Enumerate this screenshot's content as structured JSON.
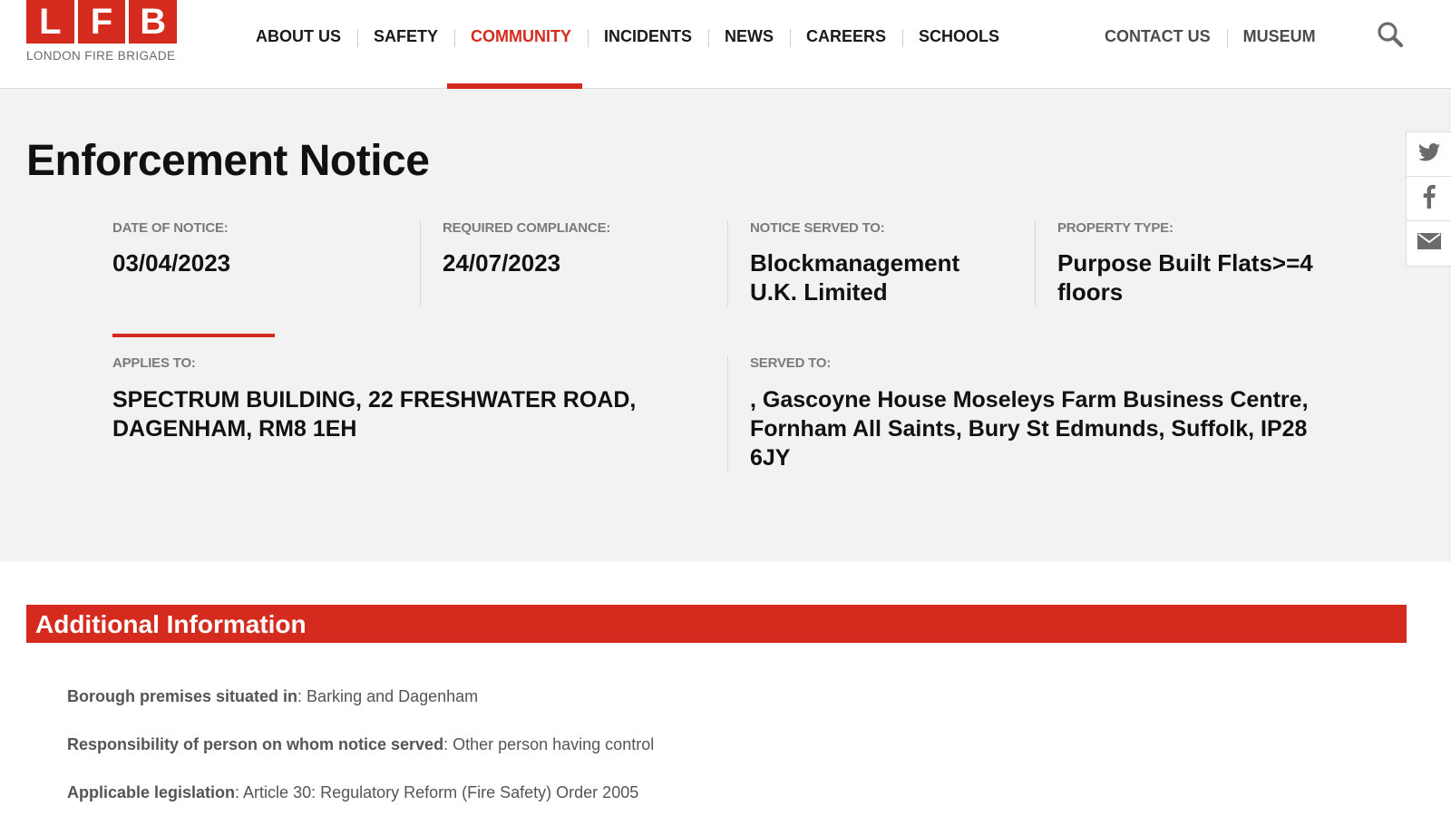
{
  "brand": {
    "logo_letters": [
      "L",
      "F",
      "B"
    ],
    "tagline": "LONDON FIRE BRIGADE",
    "accent_color": "#d52b1e"
  },
  "nav": {
    "items": [
      {
        "label": "ABOUT US"
      },
      {
        "label": "SAFETY"
      },
      {
        "label": "COMMUNITY",
        "active": true
      },
      {
        "label": "INCIDENTS"
      },
      {
        "label": "NEWS"
      },
      {
        "label": "CAREERS"
      },
      {
        "label": "SCHOOLS"
      }
    ],
    "secondary": [
      {
        "label": "CONTACT US"
      },
      {
        "label": "MUSEUM"
      }
    ],
    "search_icon": "search-icon"
  },
  "notice": {
    "title": "Enforcement Notice",
    "facts": [
      {
        "label": "DATE OF NOTICE:",
        "value": "03/04/2023"
      },
      {
        "label": "REQUIRED COMPLIANCE:",
        "value": "24/07/2023"
      },
      {
        "label": "NOTICE SERVED TO:",
        "value": "Blockmanagement U.K. Limited"
      },
      {
        "label": "PROPERTY TYPE:",
        "value": "Purpose Built Flats>=4 floors"
      }
    ],
    "applies_to": {
      "label": "APPLIES TO:",
      "value": "SPECTRUM BUILDING, 22 FRESHWATER ROAD, DAGENHAM, RM8 1EH"
    },
    "served_to": {
      "label": "SERVED TO:",
      "value": ", Gascoyne House Moseleys Farm Business Centre, Fornham All Saints, Bury St Edmunds, Suffolk, IP28 6JY"
    }
  },
  "share": {
    "icons": [
      "twitter-icon",
      "facebook-icon",
      "email-icon"
    ]
  },
  "additional": {
    "title": "Additional Information",
    "rows": [
      {
        "key": "Borough premises situated in",
        "value": ": Barking and Dagenham"
      },
      {
        "key": "Responsibility of person on whom notice served",
        "value": ": Other person having control"
      },
      {
        "key": "Applicable legislation",
        "value": ": Article 30: Regulatory Reform (Fire Safety) Order 2005"
      }
    ]
  }
}
